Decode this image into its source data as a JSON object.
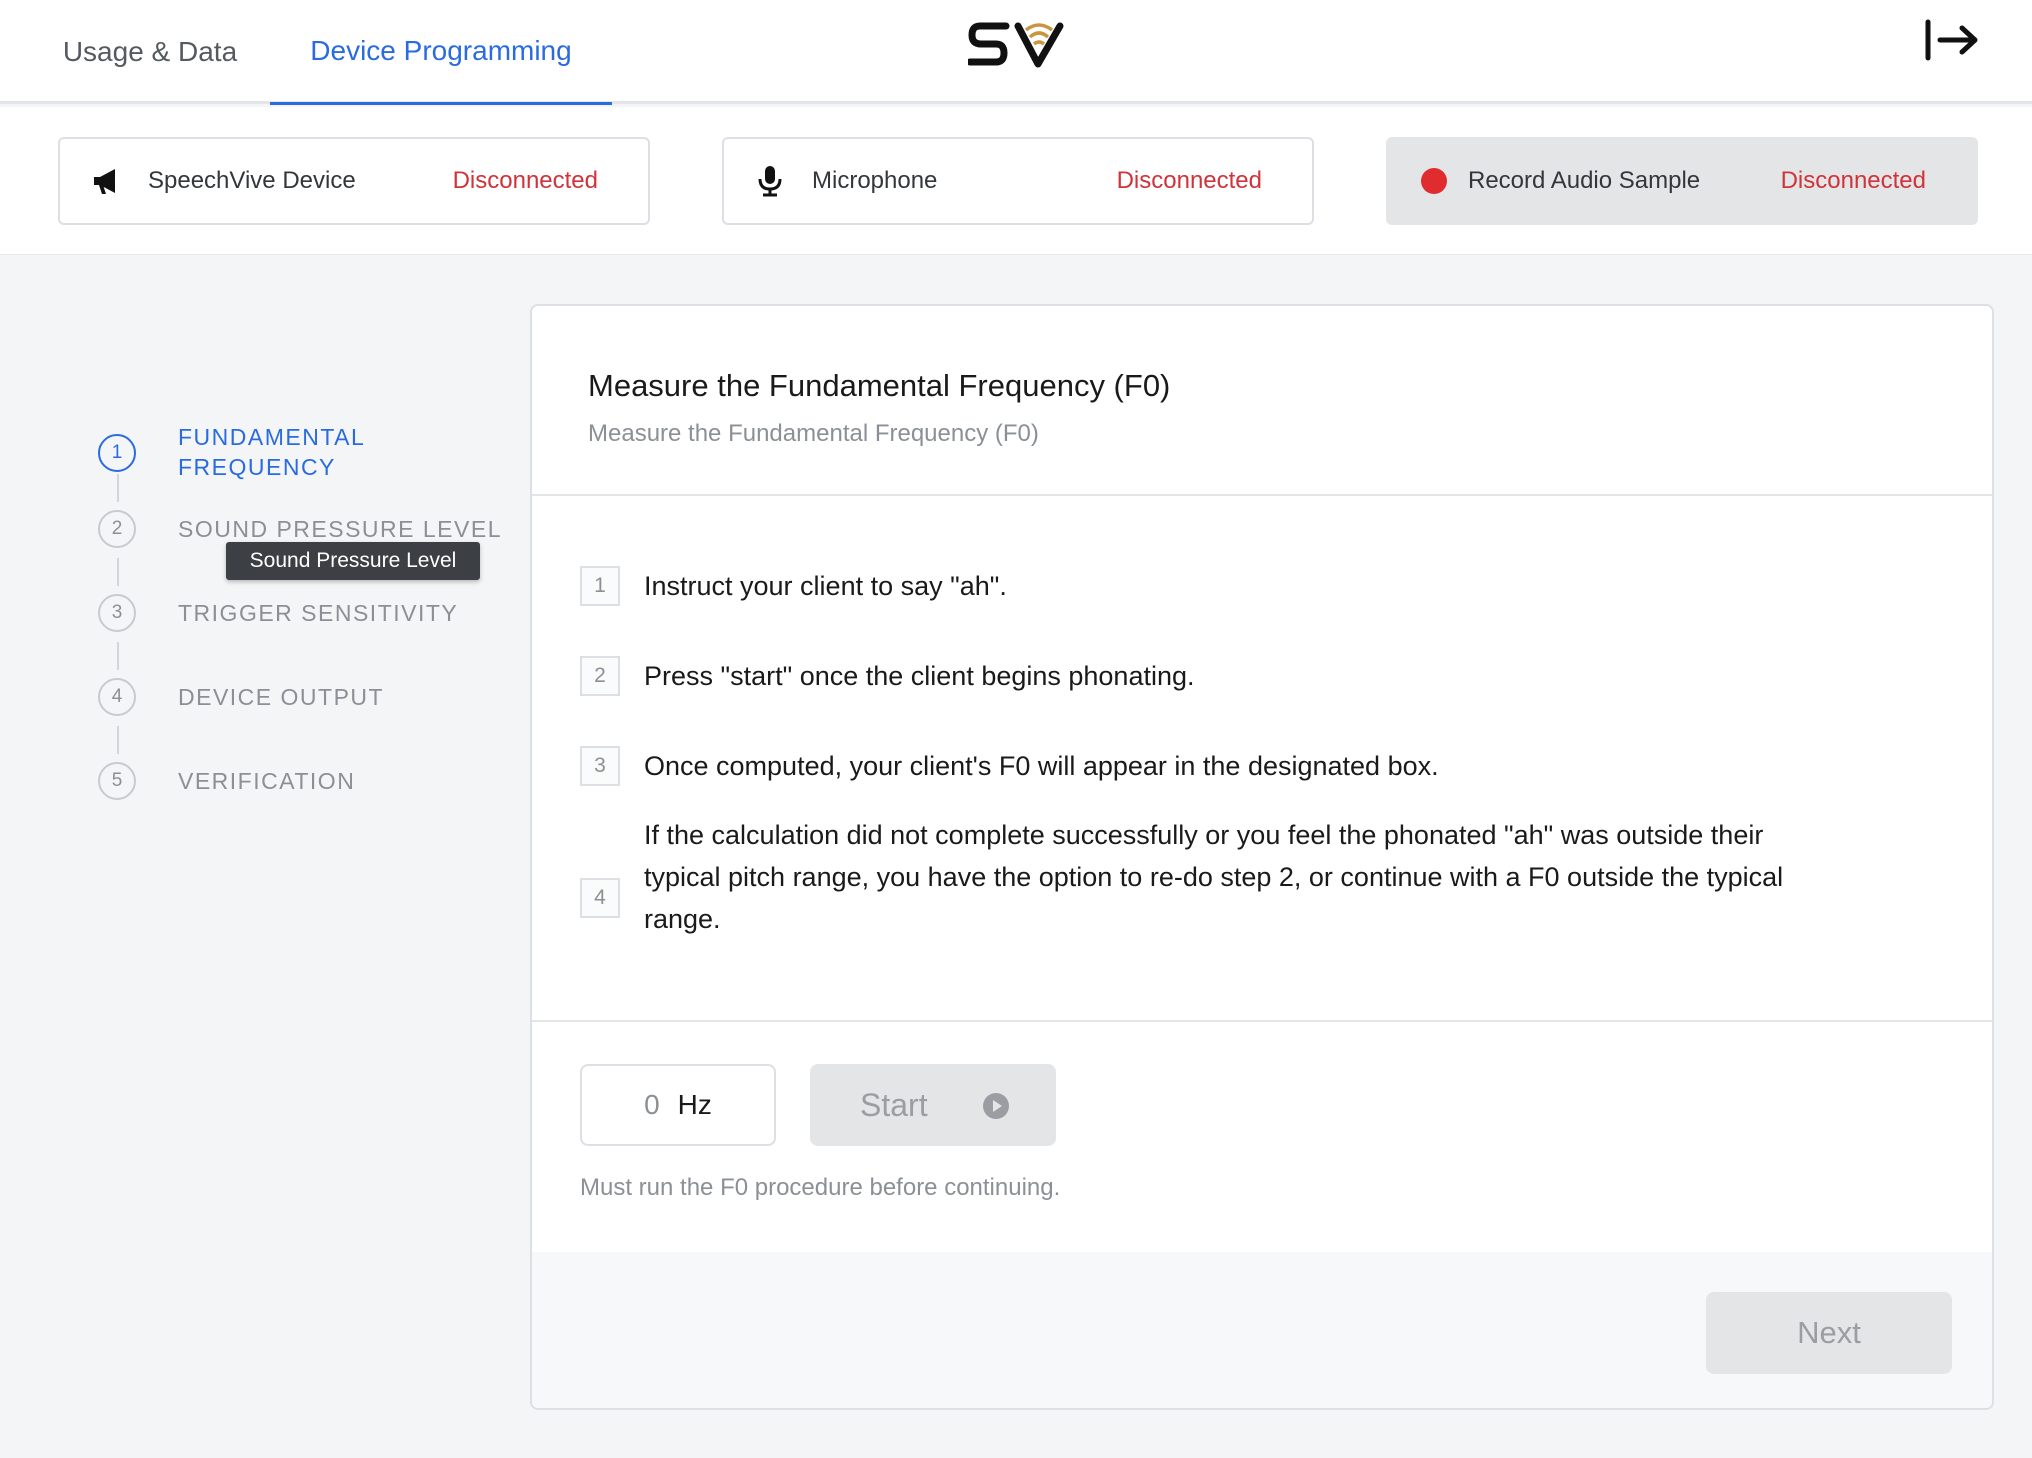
{
  "nav": {
    "tabs": [
      {
        "label": "Usage & Data",
        "active": false
      },
      {
        "label": "Device Programming",
        "active": true
      }
    ],
    "logo_icon": "sv-logo",
    "exit_icon": "sign-out-arrow-icon"
  },
  "status": {
    "cards": [
      {
        "label": "SpeechVive Device",
        "value": "Disconnected",
        "icon": "megaphone-icon"
      },
      {
        "label": "Microphone",
        "value": "Disconnected",
        "icon": "microphone-icon"
      },
      {
        "label": "Record Audio Sample",
        "value": "Disconnected",
        "icon": "record-dot-icon"
      }
    ],
    "disconnected_color": "#d1333a",
    "record_color": "#e02b2f"
  },
  "stepper": {
    "steps": [
      {
        "number": "1",
        "label_line1": "FUNDAMENTAL",
        "label_line2": "FREQUENCY",
        "active": true
      },
      {
        "number": "2",
        "label_line1": "SOUND PRESSURE LEVEL",
        "active": false
      },
      {
        "number": "3",
        "label_line1": "TRIGGER SENSITIVITY",
        "active": false
      },
      {
        "number": "4",
        "label_line1": "DEVICE OUTPUT",
        "active": false
      },
      {
        "number": "5",
        "label_line1": "VERIFICATION",
        "active": false
      }
    ],
    "tooltip": "Sound Pressure Level",
    "active_color": "#2b6be0"
  },
  "panel": {
    "title": "Measure the Fundamental Frequency (F0)",
    "subtitle": "Measure the Fundamental Frequency (F0)",
    "instructions": [
      {
        "number": "1",
        "text": "Instruct your client to say \"ah\"."
      },
      {
        "number": "2",
        "text": "Press \"start\" once the client begins phonating."
      },
      {
        "number": "3",
        "text": "Once computed, your client's F0 will appear in the designated box."
      },
      {
        "number": "4",
        "line1": "If the calculation did not complete successfully or you feel the phonated \"ah\" was outside their",
        "line2": "typical pitch range, you have the option to re-do step 2, or continue with a F0 outside the typical",
        "line3": "range."
      }
    ],
    "f0_value": "0",
    "f0_unit": "Hz",
    "start_label": "Start",
    "start_icon": "play-circle-icon",
    "hint": "Must run the F0 procedure before continuing.",
    "next_label": "Next"
  }
}
